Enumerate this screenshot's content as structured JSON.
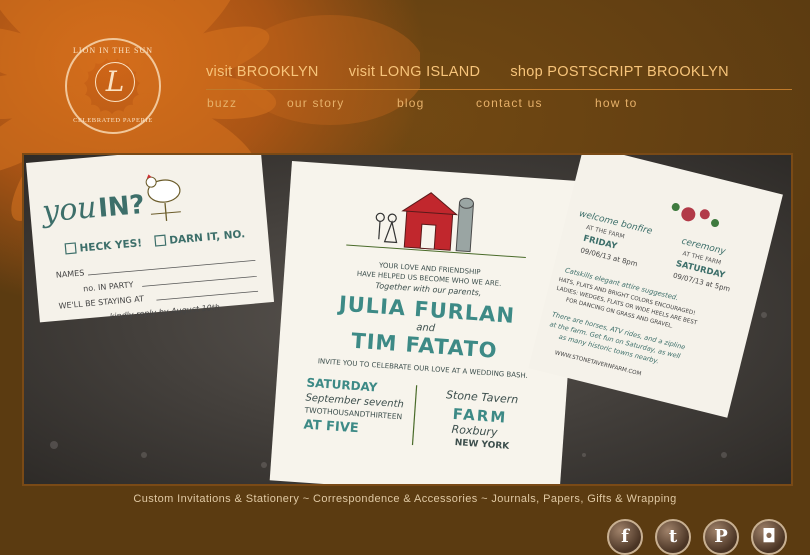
{
  "logo": {
    "ring_top": "LION IN THE SUN",
    "monogram": "L",
    "ring_bottom": "CELEBRATED PAPERIE"
  },
  "top_nav": [
    {
      "label": "visit BROOKLYN"
    },
    {
      "label": "visit LONG ISLAND"
    },
    {
      "label": "shop POSTSCRIPT BROOKLYN"
    }
  ],
  "sub_nav": [
    {
      "label": "buzz"
    },
    {
      "label": "our story"
    },
    {
      "label": "blog"
    },
    {
      "label": "contact us"
    },
    {
      "label": "how to"
    }
  ],
  "hero": {
    "rsvp": {
      "heading_you": "you",
      "heading_in": "IN?",
      "option_yes": "HECK YES!",
      "option_no": "DARN IT, NO.",
      "names": "NAMES",
      "party": "no. IN PARTY",
      "staying": "WE'LL BE STAYING AT",
      "reply": "kindly reply by August 10th"
    },
    "invite": {
      "intro1": "YOUR LOVE AND FRIENDSHIP",
      "intro2": "HAVE HELPED US BECOME WHO WE ARE.",
      "intro3": "Together with our parents,",
      "name1": "JULIA FURLAN",
      "and": "and",
      "name2": "TIM FATATO",
      "invite_line": "INVITE YOU TO CELEBRATE OUR LOVE AT A WEDDING BASH.",
      "day": "SATURDAY",
      "date": "September seventh",
      "year": "TWOTHOUSANDTHIRTEEN",
      "time": "AT FIVE",
      "venue1": "Stone Tavern",
      "venue2": "FARM",
      "venue3": "Roxbury",
      "venue4": "NEW YORK"
    },
    "details": {
      "welcome": "welcome bonfire",
      "welcome_sub": "AT THE FARM",
      "welcome_day": "FRIDAY",
      "welcome_date": "09/06/13 at 8pm",
      "ceremony": "ceremony",
      "ceremony_sub": "AT THE FARM",
      "ceremony_day": "SATURDAY",
      "ceremony_date": "09/07/13 at 5pm",
      "attire1": "Catskills elegant attire suggested.",
      "attire2": "HATS, FLATS AND BRIGHT COLORS ENCOURAGED!",
      "attire3": "LADIES: WEDGES, FLATS OR WIDE HEELS ARE BEST",
      "attire4": "FOR DANCING ON GRASS AND GRAVEL.",
      "extra1": "There are horses, ATV rides, and a zipline",
      "extra2": "at the farm. Get fun on Saturday, as well",
      "extra3": "as many historic towns nearby.",
      "url": "WWW.STONETAVERNFARM.COM"
    }
  },
  "tagline": "Custom Invitations & Stationery ~ Correspondence & Accessories ~ Journals, Papers, Gifts & Wrapping",
  "social": [
    {
      "name": "facebook",
      "glyph": "f"
    },
    {
      "name": "twitter",
      "glyph": "t"
    },
    {
      "name": "pinterest",
      "glyph": "P"
    },
    {
      "name": "instagram",
      "glyph": "◘"
    }
  ],
  "colors": {
    "background": "#5b3b11",
    "nav_text": "#f7c47a",
    "sub_nav_text": "#e6b069",
    "card_ink": "#3d6f6a",
    "barn_red": "#c1272d"
  }
}
